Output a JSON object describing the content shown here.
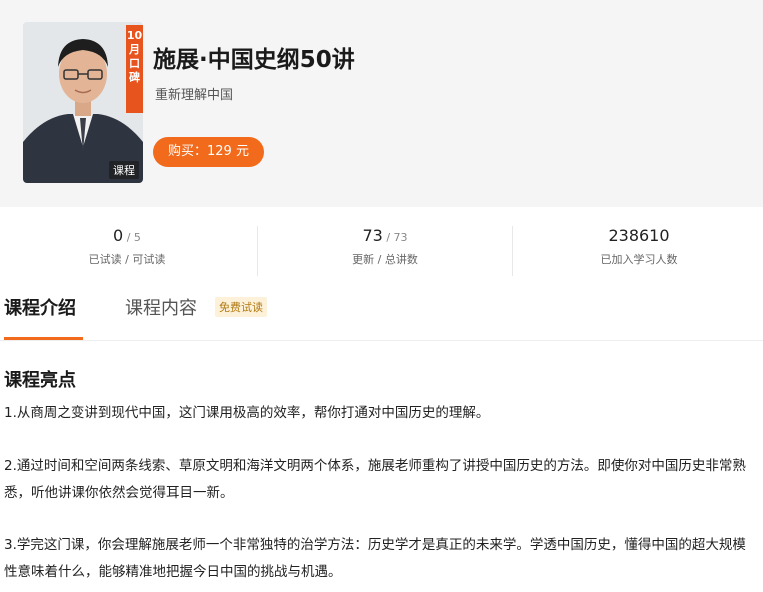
{
  "course": {
    "cover_ribbon": "10月口碑",
    "cover_tag": "课程",
    "title": "施展·中国史纲50讲",
    "subtitle": "重新理解中国",
    "buy_label": "购买：129 元"
  },
  "stats": [
    {
      "value": "0",
      "total": " / 5",
      "label": "已试读 / 可试读"
    },
    {
      "value": "73",
      "total": " / 73",
      "label": "更新 / 总讲数"
    },
    {
      "value": "238610",
      "total": "",
      "label": "已加入学习人数"
    }
  ],
  "tabs": {
    "intro": "课程介绍",
    "content": "课程内容",
    "badge": "免费试读"
  },
  "intro": {
    "heading": "课程亮点",
    "paragraphs": [
      "1.从商周之变讲到现代中国，这门课用极高的效率，帮你打通对中国历史的理解。",
      "2.通过时间和空间两条线索、草原文明和海洋文明两个体系，施展老师重构了讲授中国历史的方法。即使你对中国历史非常熟悉，听他讲课你依然会觉得耳目一新。",
      "3.学完这门课，你会理解施展老师一个非常独特的治学方法：历史学才是真正的未来学。学透中国历史，懂得中国的超大规模性意味着什么，能够精准地把握今日中国的挑战与机遇。"
    ]
  },
  "colors": {
    "accent": "#f26a1b",
    "ribbon": "#e8541e",
    "badge_bg": "#fdf1d9",
    "badge_text": "#b07a14"
  }
}
